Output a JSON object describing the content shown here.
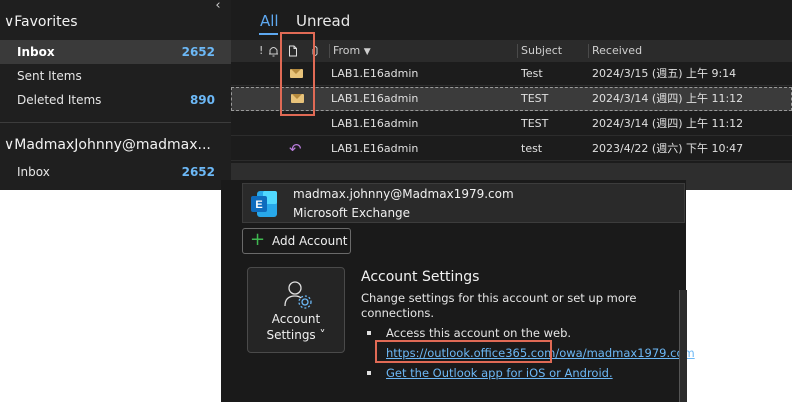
{
  "sidebar": {
    "favorites_label": "Favorites",
    "items": [
      {
        "label": "Inbox",
        "count": "2652"
      },
      {
        "label": "Sent Items",
        "count": ""
      },
      {
        "label": "Deleted Items",
        "count": "890"
      }
    ],
    "account_label": "MadmaxJohnny@madmax...",
    "account_items": [
      {
        "label": "Inbox",
        "count": "2652"
      }
    ]
  },
  "tabs": {
    "all": "All",
    "unread": "Unread"
  },
  "columns": {
    "importance": "!",
    "from": "From",
    "subject": "Subject",
    "received": "Received"
  },
  "messages": [
    {
      "from": "LAB1.E16admin",
      "subject": "Test",
      "received": "2024/3/15 (週五) 上午 9:14",
      "icon": "envelope-icon"
    },
    {
      "from": "LAB1.E16admin",
      "subject": "TEST",
      "received": "2024/3/14 (週四) 上午 11:12",
      "icon": "envelope-icon"
    },
    {
      "from": "LAB1.E16admin",
      "subject": "TEST",
      "received": "2024/3/14 (週四) 上午 11:12",
      "icon": ""
    },
    {
      "from": "LAB1.E16admin",
      "subject": "test",
      "received": "2023/4/22 (週六) 下午 10:47",
      "icon": "reply-icon"
    }
  ],
  "account": {
    "email": "madmax.johnny@Madmax1979.com",
    "type": "Microsoft Exchange",
    "add_account": "Add Account",
    "tile_line1": "Account",
    "tile_line2": "Settings ˅",
    "settings_title": "Account Settings",
    "settings_desc": "Change settings for this account or set up more connections.",
    "web_access": "Access this account on the web.",
    "web_link": "https://outlook.office365.com/owa/madmax1979.com",
    "app_link": "Get the Outlook app for iOS or Android."
  },
  "colors": {
    "accent": "#6cb8f6",
    "highlight_box": "#e06a55",
    "exchange_blue": "#1a78d4"
  }
}
